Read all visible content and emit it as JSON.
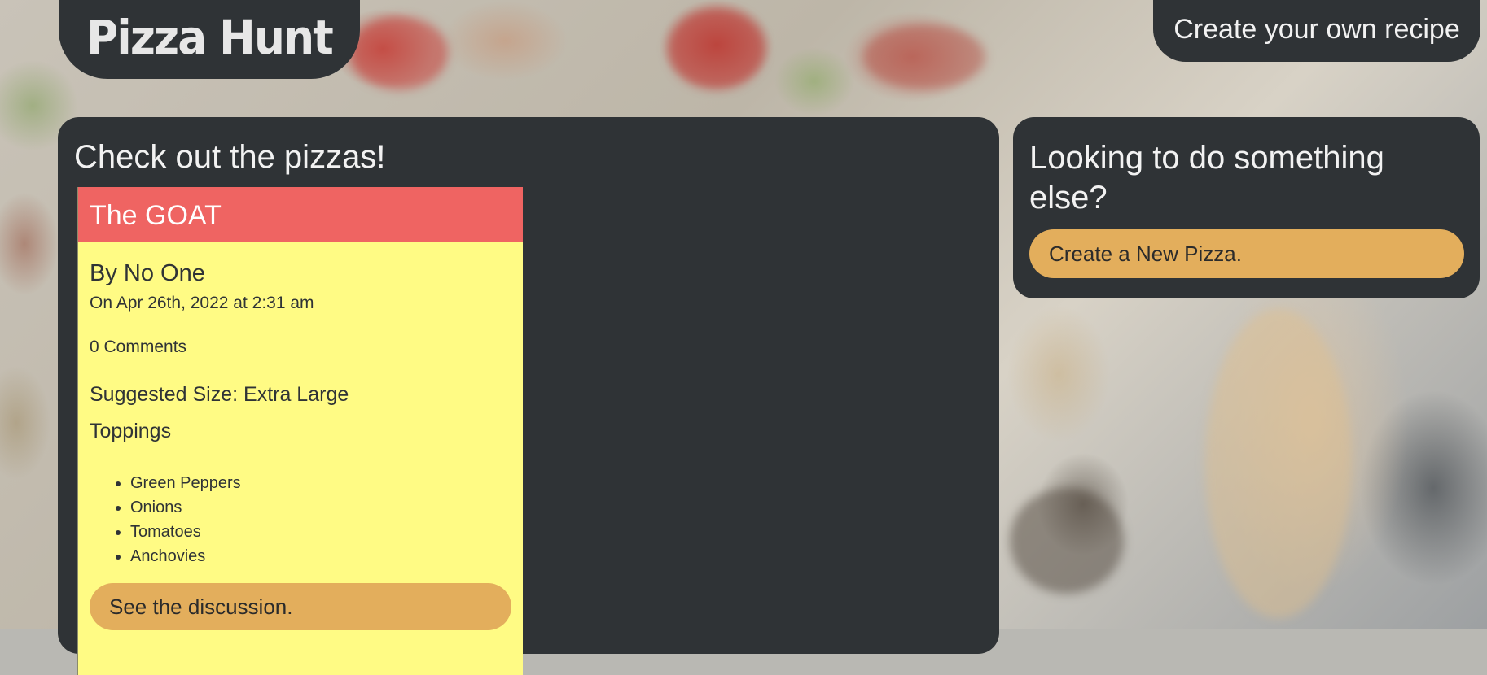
{
  "header": {
    "logo_text": "Pizza Hunt",
    "create_link": "Create your own recipe"
  },
  "main": {
    "title": "Check out the pizzas!",
    "pizzas": [
      {
        "name": "The GOAT",
        "author": "By No One",
        "date": "On Apr 26th, 2022 at 2:31 am",
        "comments": "0 Comments",
        "size": "Suggested Size: Extra Large",
        "toppings_label": "Toppings",
        "toppings": [
          "Green Peppers",
          "Onions",
          "Tomatoes",
          "Anchovies"
        ],
        "discussion_label": "See the discussion."
      }
    ]
  },
  "sidebar": {
    "title": "Looking to do something else?",
    "button_label": "Create a New Pizza."
  },
  "colors": {
    "panel": "#2f3336",
    "card_header": "#ef6462",
    "card_body": "#fffb84",
    "button": "#e3ae5c"
  }
}
